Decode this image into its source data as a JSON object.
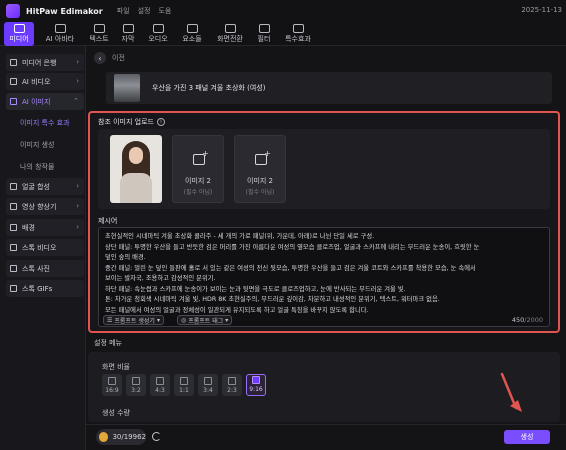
{
  "app": {
    "name": "HitPaw Edimakor",
    "menu": [
      "파일",
      "설정",
      "도움"
    ],
    "date": "2025-11-13"
  },
  "toolbar": {
    "tools": [
      {
        "label": "미디어",
        "icon": "media-icon",
        "active": true
      },
      {
        "label": "AI 아바타",
        "icon": "ai-avatar-icon",
        "active": false
      },
      {
        "label": "텍스트",
        "icon": "text-icon",
        "active": false
      },
      {
        "label": "자막",
        "icon": "subtitle-icon",
        "active": false
      },
      {
        "label": "오디오",
        "icon": "audio-icon",
        "active": false
      },
      {
        "label": "요소들",
        "icon": "elements-icon",
        "active": false
      },
      {
        "label": "화면전환",
        "icon": "transition-icon",
        "active": false
      },
      {
        "label": "필터",
        "icon": "filter-icon",
        "active": false
      },
      {
        "label": "특수효과",
        "icon": "effects-icon",
        "active": false
      }
    ]
  },
  "sidebar": {
    "items": [
      {
        "label": "미디어 은행",
        "chevron": "›"
      },
      {
        "label": "AI 비디오",
        "chevron": "›"
      },
      {
        "label": "AI 이미지",
        "chevron": "⌃",
        "expanded": true
      },
      {
        "label": "얼굴 합성",
        "chevron": "›"
      },
      {
        "label": "영상 향상기",
        "chevron": "›"
      },
      {
        "label": "배경",
        "chevron": "›"
      },
      {
        "label": "스톡 비디오",
        "chevron": ""
      },
      {
        "label": "스톡 사진",
        "chevron": ""
      },
      {
        "label": "스톡 GIFs",
        "chevron": ""
      }
    ],
    "subitems": [
      {
        "label": "이미지 특수 효과",
        "active": true
      },
      {
        "label": "이미지 생성",
        "active": false
      },
      {
        "label": "나의 창작물",
        "active": false
      }
    ]
  },
  "main": {
    "back_label": "이전",
    "template_title": "우산을 가진 3 패널 겨울 초상화 (여성)",
    "upload_title": "참조 이미지 업로드",
    "slots": [
      {
        "label": "이미지 2",
        "sub": "(필수 아님)"
      },
      {
        "label": "이미지 2",
        "sub": "(필수 아님)"
      }
    ],
    "prompt_title": "제시어",
    "prompt_lines": [
      "초현실적인 시네마틱 겨울 초상화 콜라주 - 세 개의 가로 패널(위, 가운데, 아래)로 나뉜 단일 세로 구성.",
      "상단 패널: 투명한 우산을 들고 반듯한 검은 머리를 가진 아름다운 여성의 옆모습 클로즈업, 얼굴과 스카프에 내리는 부드러운 눈송이, 흐릿한 눈",
      "덮인 숲의 배경.",
      "중간 패널: 멀린 눈 덮인 들판에 홀로 서 있는 같은 여성의 전신 뒷모습, 투명한 우산을 들고 검은 겨울 코트와 스카프를 착용한 모습, 눈 속에서",
      "보이는 발자국, 조용하고 감성적인 분위기.",
      "하단 패널: 속눈썹과 스카프에 눈송이가 보이는 눈과 뒷면을 극도로 클로즈업하고, 눈에 반사되는 부드러운 겨울 빛.",
      "톤: 차가운 청회색 시네마틱 겨울 빛, HDR 8K 초현실주의, 부드러운 깊이감, 차분하고 내성적인 분위기, 텍스트, 워터마크 없음.",
      "모든 패널에서 여성의 얼굴과 정체성이 일관되게 유지되도록 하고 얼굴 특징을 바꾸지 않도록 합니다."
    ],
    "prompt_generator_label": "프롬프트 생성기",
    "prompt_tag_label": "프롬프트 태그",
    "char_count": "450",
    "char_max": "/2000",
    "settings_title": "설정 메뉴",
    "ratio_title": "화면 비율",
    "ratios": [
      {
        "label": "16:9",
        "active": false
      },
      {
        "label": "3:2",
        "active": false
      },
      {
        "label": "4:3",
        "active": false
      },
      {
        "label": "1:1",
        "active": false
      },
      {
        "label": "3:4",
        "active": false
      },
      {
        "label": "2:3",
        "active": false
      },
      {
        "label": "9:16",
        "active": true
      }
    ],
    "count_title": "생성 수량"
  },
  "bottom": {
    "credits": "30/19962",
    "generate_label": "생성"
  },
  "colors": {
    "accent": "#7a4dff",
    "highlight_border": "#e05550",
    "arrow": "#e05550"
  }
}
